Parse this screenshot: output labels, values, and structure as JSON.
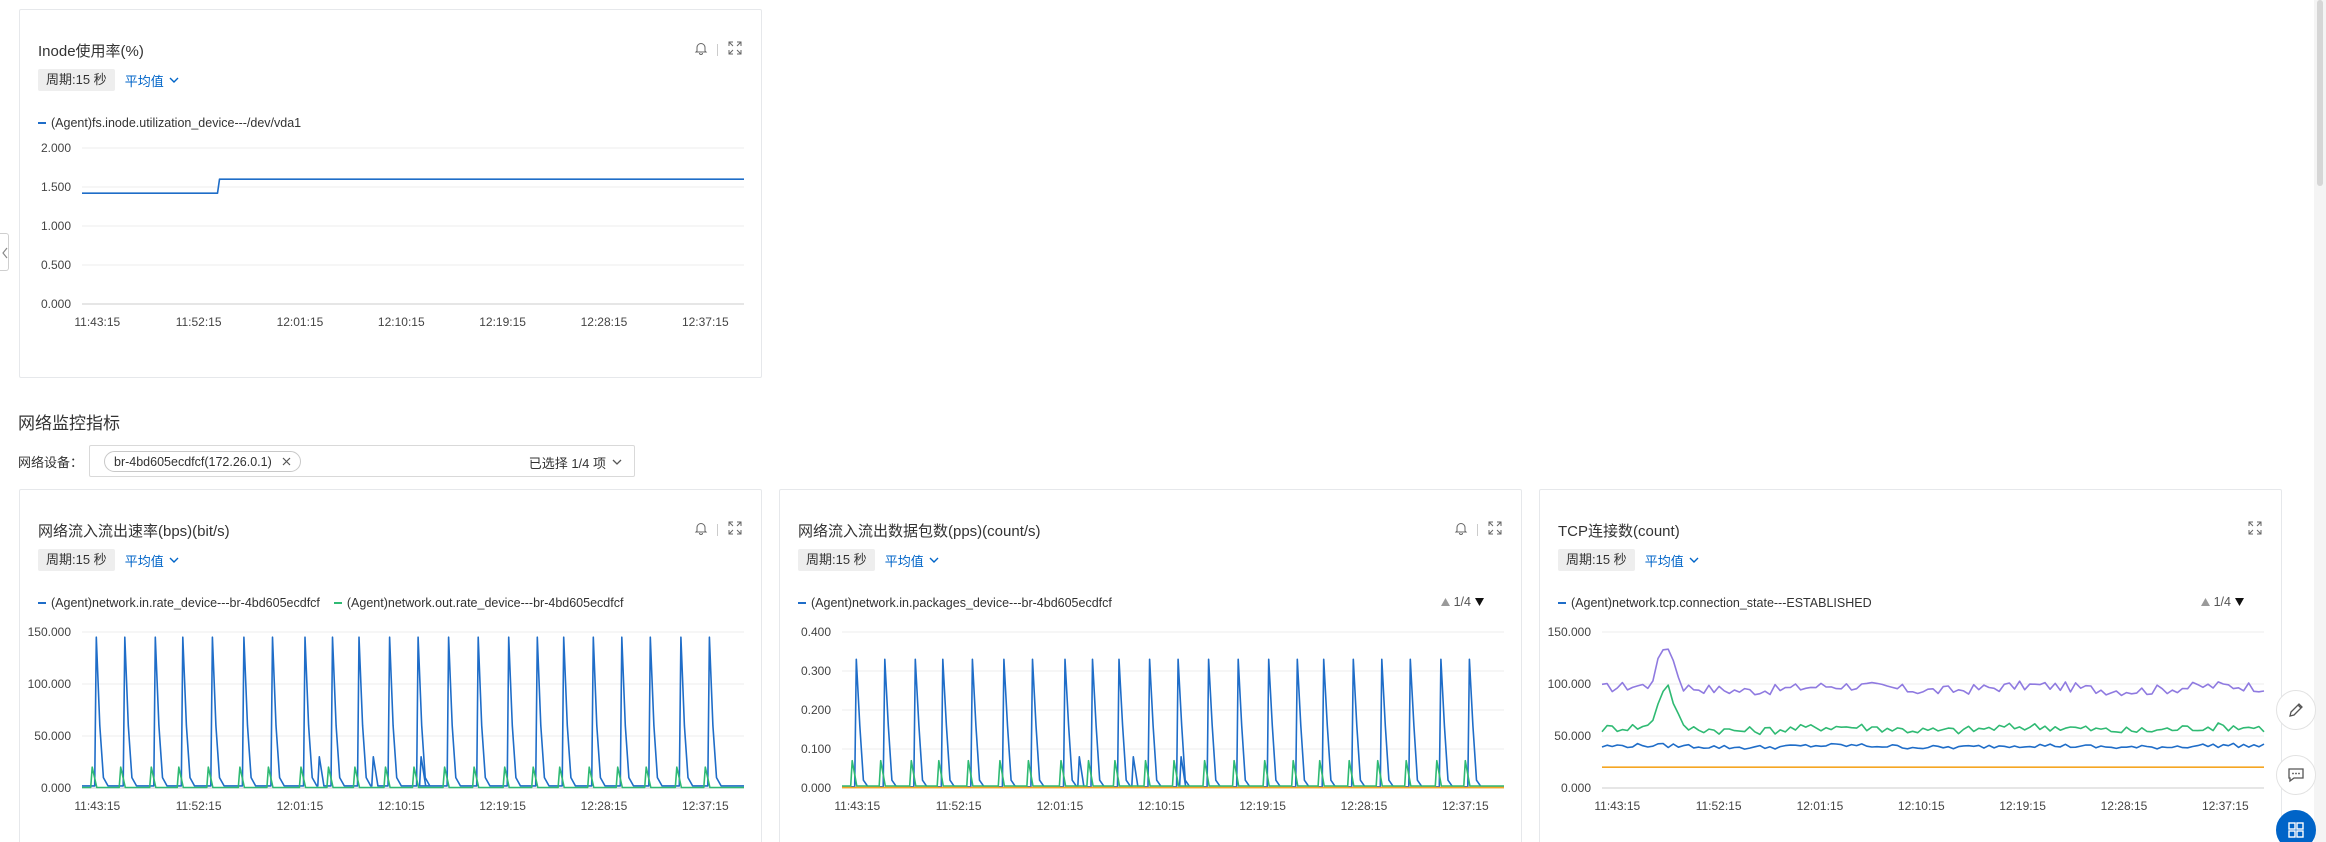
{
  "inode_card": {
    "title": "Inode使用率(%)",
    "period": "周期:15 秒",
    "aggregation": "平均值"
  },
  "network_section": {
    "title": "网络监控指标",
    "device_label": "网络设备：",
    "device_tag": "br-4bd605ecdfcf(172.26.0.1)",
    "selected_count": "已选择 1/4 项"
  },
  "traffic_card": {
    "title": "网络流入流出速率(bps)(bit/s)",
    "period": "周期:15 秒",
    "aggregation": "平均值"
  },
  "packets_card": {
    "title": "网络流入流出数据包数(pps)(count/s)",
    "period": "周期:15 秒",
    "aggregation": "平均值",
    "pager": "1/4"
  },
  "tcp_card": {
    "title": "TCP连接数(count)",
    "period": "周期:15 秒",
    "aggregation": "平均值",
    "pager": "1/4"
  },
  "icons": [
    "bell-icon",
    "fullscreen-icon",
    "chevron-down-icon",
    "close-icon",
    "edit-icon",
    "chat-icon",
    "apps-icon"
  ],
  "colors": {
    "blue": "#1f6dc8",
    "green": "#2fba73",
    "orange": "#f5a623",
    "purple": "#8f7ae0",
    "accent": "#0064c8"
  },
  "chart_data": [
    {
      "type": "line",
      "title": "Inode使用率(%)",
      "x_ticks": [
        "11:43:15",
        "11:52:15",
        "12:01:15",
        "12:10:15",
        "12:19:15",
        "12:28:15",
        "12:37:15"
      ],
      "ylim": [
        0,
        2
      ],
      "y_ticks": [
        "0.000",
        "0.500",
        "1.000",
        "1.500",
        "2.000"
      ],
      "grid": true,
      "legend_position": "top-left",
      "series": [
        {
          "name": "(Agent)fs.inode.utilization_device---/dev/vda1",
          "color": "#1f6dc8",
          "points": [
            [
              0,
              1.42
            ],
            [
              13.3,
              1.42
            ],
            [
              13.5,
              1.6
            ],
            [
              65,
              1.6
            ]
          ]
        }
      ]
    },
    {
      "type": "line",
      "title": "网络流入流出速率(bps)(bit/s)",
      "x_ticks": [
        "11:43:15",
        "11:52:15",
        "12:01:15",
        "12:10:15",
        "12:19:15",
        "12:28:15",
        "12:37:15"
      ],
      "ylim": [
        0,
        150000
      ],
      "y_ticks": [
        "0.000",
        "50.000",
        "100.000",
        "150.000"
      ],
      "grid": true,
      "legend_position": "top-left",
      "series": [
        {
          "name": "(Agent)network.in.rate_device---br-4bd605ecdfcf",
          "color": "#1f6dc8",
          "baseline": 2000,
          "spike_pattern": [
            145000,
            60000,
            10000
          ],
          "minor_pattern": [
            30000
          ],
          "spike_positions": [
            1.4,
            4.2,
            7.2,
            9.9,
            12.8,
            15.9,
            18.7,
            21.9,
            24.6,
            27.2,
            30.2,
            33.0,
            36.0,
            38.9,
            41.9,
            44.7,
            47.3,
            50.2,
            53.0,
            55.8,
            58.8,
            61.6
          ],
          "minor_positions": [
            23.3,
            28.6,
            33.3
          ]
        },
        {
          "name": "(Agent)network.out.rate_device---br-4bd605ecdfcf",
          "color": "#2fba73",
          "baseline": 500,
          "spike_pattern": [
            20000
          ],
          "spike_positions": [
            1.0,
            3.8,
            6.8,
            9.5,
            12.4,
            15.5,
            18.3,
            21.5,
            24.2,
            26.8,
            29.8,
            32.6,
            35.6,
            38.5,
            41.5,
            44.3,
            46.9,
            49.8,
            52.6,
            55.4,
            58.4,
            61.2
          ]
        }
      ]
    },
    {
      "type": "line",
      "title": "网络流入流出数据包数(pps)(count/s)",
      "x_ticks": [
        "11:43:15",
        "11:52:15",
        "12:01:15",
        "12:10:15",
        "12:19:15",
        "12:28:15",
        "12:37:15"
      ],
      "ylim": [
        0,
        0.4
      ],
      "y_ticks": [
        "0.000",
        "0.100",
        "0.200",
        "0.300",
        "0.400"
      ],
      "grid": true,
      "legend_position": "top-left",
      "series": [
        {
          "name": "(Agent)network.in.packages_device---br-4bd605ecdfcf",
          "color": "#1f6dc8",
          "baseline": 0.003,
          "spike_pattern": [
            0.33,
            0.16,
            0.02
          ],
          "minor_pattern": [
            0.08
          ],
          "spike_positions": [
            1.4,
            4.2,
            7.2,
            9.9,
            12.8,
            15.9,
            18.7,
            21.9,
            24.6,
            27.2,
            30.2,
            33.0,
            36.0,
            38.9,
            41.9,
            44.7,
            47.3,
            50.2,
            53.0,
            55.8,
            58.8,
            61.6
          ],
          "minor_positions": [
            23.3,
            28.6,
            33.3
          ]
        },
        {
          "name": "",
          "color": "#2fba73",
          "baseline": 0.005,
          "spike_pattern": [
            0.07
          ],
          "spike_positions": [
            1.0,
            3.8,
            6.8,
            9.5,
            12.4,
            15.5,
            18.3,
            21.5,
            24.2,
            26.8,
            29.8,
            32.6,
            35.6,
            38.5,
            41.5,
            44.3,
            46.9,
            49.8,
            52.6,
            55.4,
            58.4,
            61.2
          ]
        },
        {
          "name": "",
          "color": "#f5a623",
          "constant": 0.001
        }
      ]
    },
    {
      "type": "line",
      "title": "TCP连接数(count)",
      "x_ticks": [
        "11:43:15",
        "11:52:15",
        "12:01:15",
        "12:10:15",
        "12:19:15",
        "12:28:15",
        "12:37:15"
      ],
      "ylim": [
        0,
        150000
      ],
      "y_ticks": [
        "0.000",
        "50.000",
        "100.000",
        "150.000"
      ],
      "grid": true,
      "legend_position": "top-left",
      "series": [
        {
          "name": "",
          "color": "#8f7ae0",
          "noisy_base": 96000,
          "amplitude": 6000,
          "peak_x": 6.3,
          "peak_y": 140000
        },
        {
          "name": "",
          "color": "#2fba73",
          "noisy_base": 57000,
          "amplitude": 5000,
          "peak_x": 6.3,
          "peak_y": 102000
        },
        {
          "name": "(Agent)network.tcp.connection_state---ESTABLISHED",
          "color": "#1f6dc8",
          "noisy_base": 40000,
          "amplitude": 2500
        },
        {
          "name": "",
          "color": "#f5a623",
          "constant": 20000
        }
      ]
    }
  ]
}
